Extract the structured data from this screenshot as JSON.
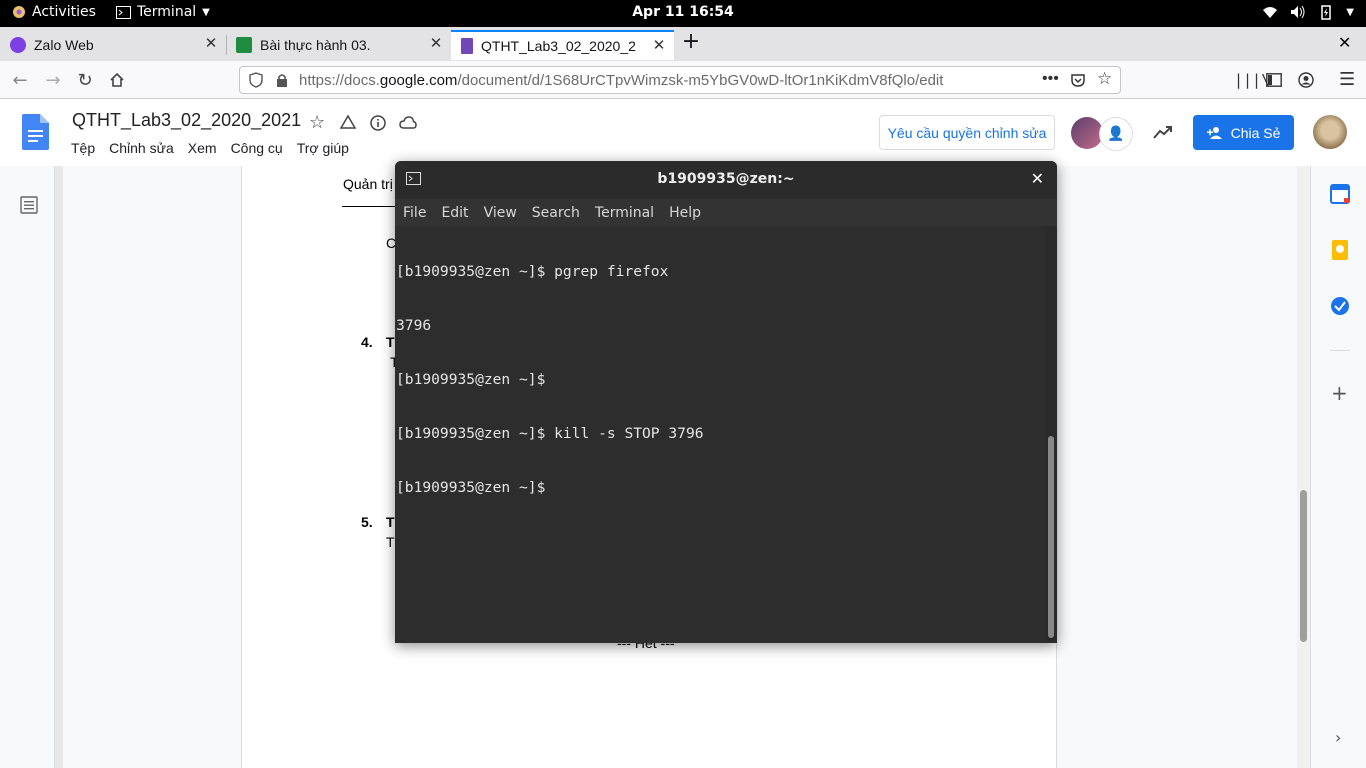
{
  "topbar": {
    "activities": "Activities",
    "app_name": "Terminal",
    "clock": "Apr 11  16:54"
  },
  "tabs": [
    {
      "title": "Zalo Web",
      "favicon": "zalo-icon"
    },
    {
      "title": "Bài thực hành 03.",
      "favicon": "classroom-icon"
    },
    {
      "title": "QTHT_Lab3_02_2020_2",
      "favicon": "docs-icon"
    }
  ],
  "navbar": {
    "url_prefix": "https://docs.",
    "url_domain": "google.com",
    "url_path": "/document/d/1S68UrCTpvWimzsk-m5YbGV0wD-ltOr1nKiKdmV8fQlo/edit"
  },
  "docs": {
    "title": "QTHT_Lab3_02_2020_2021",
    "menu": [
      "Tệp",
      "Chỉnh sửa",
      "Xem",
      "Công cụ",
      "Trợ giúp"
    ],
    "request_edit": "Yêu cầu quyền chỉnh sửa",
    "share": "Chia Sẻ",
    "fragments": {
      "header_text": "Quản trị",
      "c": "C",
      "n4": "4.",
      "t4": "T",
      "t4b": "T",
      "n5": "5.",
      "t5": "T",
      "t5b": "T",
      "footer": "--- Hết ---"
    }
  },
  "terminal": {
    "title": "b1909935@zen:~",
    "menu": [
      "File",
      "Edit",
      "View",
      "Search",
      "Terminal",
      "Help"
    ],
    "lines": [
      "[b1909935@zen ~]$ pgrep firefox",
      "3796",
      "[b1909935@zen ~]$",
      "[b1909935@zen ~]$ kill -s STOP 3796",
      "[b1909935@zen ~]$"
    ]
  },
  "colors": {
    "accent": "#0a84ff",
    "docs_blue": "#1a73e8",
    "terminal_bg": "#2d2d2d"
  }
}
